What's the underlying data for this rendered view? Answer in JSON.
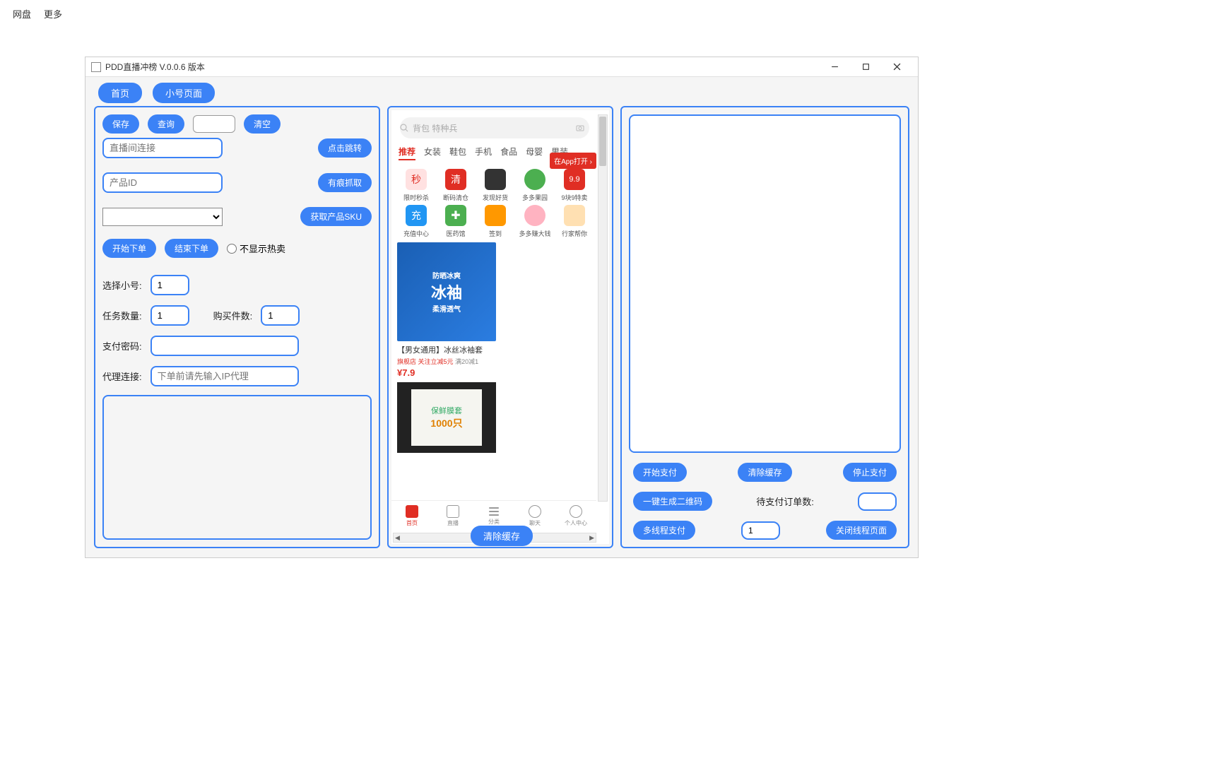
{
  "top_menu": {
    "item1": "网盘",
    "item2": "更多"
  },
  "window": {
    "title": "PDD直播冲榜 V.0.0.6 版本"
  },
  "tabs": {
    "home": "首页",
    "sub_account": "小号页面"
  },
  "left": {
    "save": "保存",
    "query": "查询",
    "clear": "清空",
    "short_input": "",
    "live_link_placeholder": "直播间连接",
    "jump": "点击跳转",
    "product_id_placeholder": "产品ID",
    "trace_grab": "有痕抓取",
    "sku_select": "",
    "get_sku": "获取产品SKU",
    "start_order": "开始下单",
    "end_order": "结束下单",
    "no_hot_radio": "不显示热卖",
    "select_sub_label": "选择小号:",
    "select_sub_value": "1",
    "task_count_label": "任务数量:",
    "task_count_value": "1",
    "buy_count_label": "购买件数:",
    "buy_count_value": "1",
    "pay_pwd_label": "支付密码:",
    "pay_pwd_value": "",
    "proxy_label": "代理连接:",
    "proxy_placeholder": "下单前请先输入IP代理"
  },
  "phone": {
    "search_hint": "背包 特种兵",
    "cats": [
      "推荐",
      "女装",
      "鞋包",
      "手机",
      "食品",
      "母婴",
      "男装"
    ],
    "app_open": "在App打开",
    "grid1": [
      "限时秒杀",
      "断码清仓",
      "发现好货",
      "多多果园",
      "9块9特卖"
    ],
    "grid2": [
      "充值中心",
      "医药馆",
      "签到",
      "多多赚大钱",
      "行家帮你"
    ],
    "product1": {
      "img_text": "冰袖",
      "title": "【男女通用】冰丝冰袖套",
      "tag1": "旗舰店",
      "tag2": "关注立减5元",
      "tag3": "满20减1",
      "price": "¥7.9"
    },
    "product2": {
      "line1": "保鲜膜套",
      "line2": "1000只"
    },
    "nav": [
      "首页",
      "直播",
      "分类",
      "聊天",
      "个人中心"
    ]
  },
  "right": {
    "start_pay": "开始支付",
    "clear_cache": "清除缓存",
    "stop_pay": "停止支付",
    "gen_qr": "一键生成二维码",
    "pending_label": "待支付订单数:",
    "pending_value": "",
    "multi_pay": "多线程支付",
    "thread_value": "1",
    "close_thread": "关闭线程页面"
  },
  "bottom": {
    "clear_cache": "清除缓存"
  }
}
